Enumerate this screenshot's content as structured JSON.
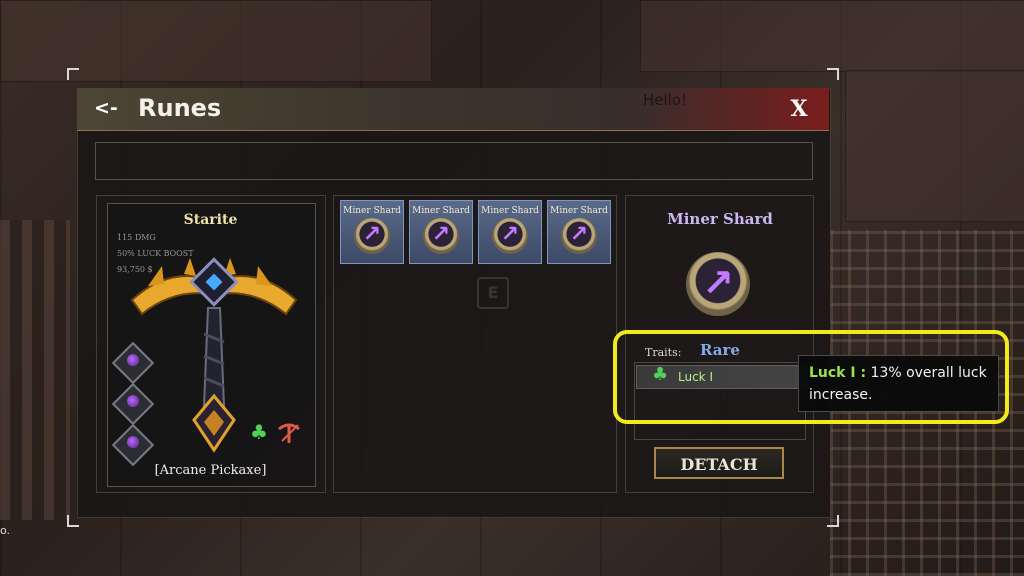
{
  "window": {
    "title": "Runes",
    "back_label": "<-",
    "close_label": "X",
    "ghost_text": "Hello!"
  },
  "tool": {
    "name": "Starite",
    "stats": [
      "115 DMG",
      "50% LUCK BOOST",
      "93,750 $"
    ],
    "type": "[Arcane Pickaxe]",
    "rune_slots": 3
  },
  "inventory": {
    "runes": [
      {
        "label": "Miner Shard"
      },
      {
        "label": "Miner Shard"
      },
      {
        "label": "Miner Shard"
      },
      {
        "label": "Miner Shard"
      }
    ],
    "hint_key": "E"
  },
  "detail": {
    "name": "Miner Shard",
    "traits_label": "Traits:",
    "rarity": "Rare",
    "trait": "Luck I",
    "detach_label": "DETACH"
  },
  "tooltip": {
    "trait": "Luck I :",
    "text": " 13% overall luck increase."
  },
  "edge_text": "o.",
  "colors": {
    "accent_gold": "#f0e2a8",
    "rune_purple": "#c27bff",
    "luck_green": "#9be34a",
    "highlight_yellow": "#f2ea1a",
    "rarity_blue": "#86a9e8"
  },
  "icons": {
    "rune": "arrow-rune-icon",
    "luck": "clover-icon",
    "pickaxe": "pickaxe-icon"
  }
}
